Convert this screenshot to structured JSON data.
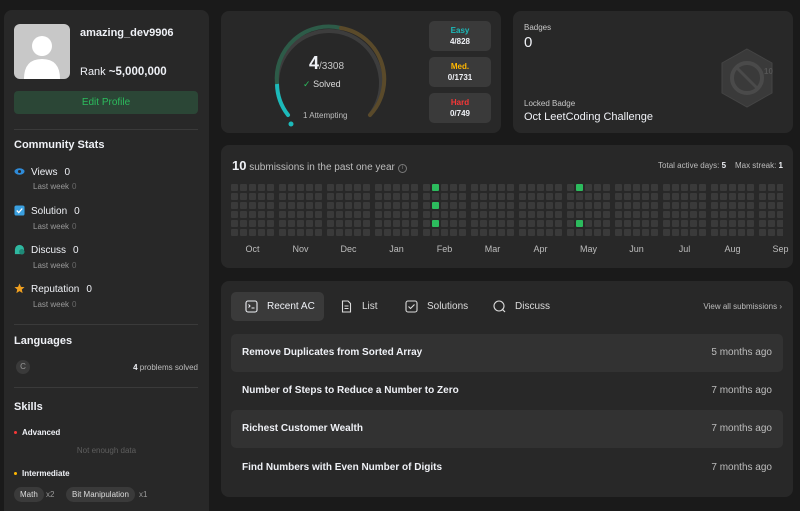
{
  "profile": {
    "username": "amazing_dev9906",
    "rank_label": "Rank",
    "rank_value": "~5,000,000",
    "edit_label": "Edit Profile"
  },
  "community": {
    "title": "Community Stats",
    "stats": [
      {
        "icon": "eye-icon",
        "label": "Views",
        "value": "0",
        "sub_label": "Last week",
        "sub_value": "0",
        "color": "#2f8bd8"
      },
      {
        "icon": "solution-icon",
        "label": "Solution",
        "value": "0",
        "sub_label": "Last week",
        "sub_value": "0",
        "color": "#3aa0e0"
      },
      {
        "icon": "discuss-icon",
        "label": "Discuss",
        "value": "0",
        "sub_label": "Last week",
        "sub_value": "0",
        "color": "#2fb8a0"
      },
      {
        "icon": "star-icon",
        "label": "Reputation",
        "value": "0",
        "sub_label": "Last week",
        "sub_value": "0",
        "color": "#f0a020"
      }
    ]
  },
  "languages": {
    "title": "Languages",
    "items": [
      {
        "name": "C",
        "count": "4",
        "suffix": "problems solved"
      }
    ]
  },
  "skills": {
    "title": "Skills",
    "advanced_label": "Advanced",
    "advanced_empty": "Not enough data",
    "intermediate_label": "Intermediate",
    "tags": [
      {
        "name": "Math",
        "count": "x2"
      },
      {
        "name": "Bit Manipulation",
        "count": "x1"
      }
    ]
  },
  "solved": {
    "count": "4",
    "total": "/3308",
    "label": "Solved",
    "attempting": "1 Attempting",
    "progress_fraction": 0.0012,
    "difficulties": [
      {
        "label": "Easy",
        "value": "4/828",
        "color": "#1cbaba"
      },
      {
        "label": "Med.",
        "value": "0/1731",
        "color": "#ffb700"
      },
      {
        "label": "Hard",
        "value": "0/749",
        "color": "#f63737"
      }
    ]
  },
  "badges": {
    "label": "Badges",
    "count": "0",
    "locked_label": "Locked Badge",
    "locked_name": "Oct LeetCoding Challenge",
    "badge_number": "10"
  },
  "activity": {
    "count": "10",
    "title_suffix": "submissions in the past one year",
    "info_icon": "info-icon",
    "active_days_label": "Total active days:",
    "active_days": "5",
    "max_streak_label": "Max streak:",
    "max_streak": "1",
    "months": [
      "Oct",
      "Nov",
      "Dec",
      "Jan",
      "Feb",
      "Mar",
      "Apr",
      "May",
      "Jun",
      "Jul",
      "Aug",
      "Sep"
    ],
    "active_cells": [
      {
        "month": "Feb",
        "day_of_week": 0
      },
      {
        "month": "Feb",
        "day_of_week": 2
      },
      {
        "month": "Feb",
        "day_of_week": 4
      },
      {
        "month": "May",
        "day_of_week": 0
      },
      {
        "month": "May",
        "day_of_week": 4
      }
    ]
  },
  "submissions": {
    "tabs": [
      {
        "label": "Recent AC",
        "icon": "recent-ac-icon"
      },
      {
        "label": "List",
        "icon": "list-icon"
      },
      {
        "label": "Solutions",
        "icon": "solutions-icon"
      },
      {
        "label": "Discuss",
        "icon": "discuss-icon"
      }
    ],
    "view_all": "View all submissions",
    "rows": [
      {
        "title": "Remove Duplicates from Sorted Array",
        "time": "5 months ago"
      },
      {
        "title": "Number of Steps to Reduce a Number to Zero",
        "time": "7 months ago"
      },
      {
        "title": "Richest Customer Wealth",
        "time": "7 months ago"
      },
      {
        "title": "Find Numbers with Even Number of Digits",
        "time": "7 months ago"
      }
    ]
  }
}
